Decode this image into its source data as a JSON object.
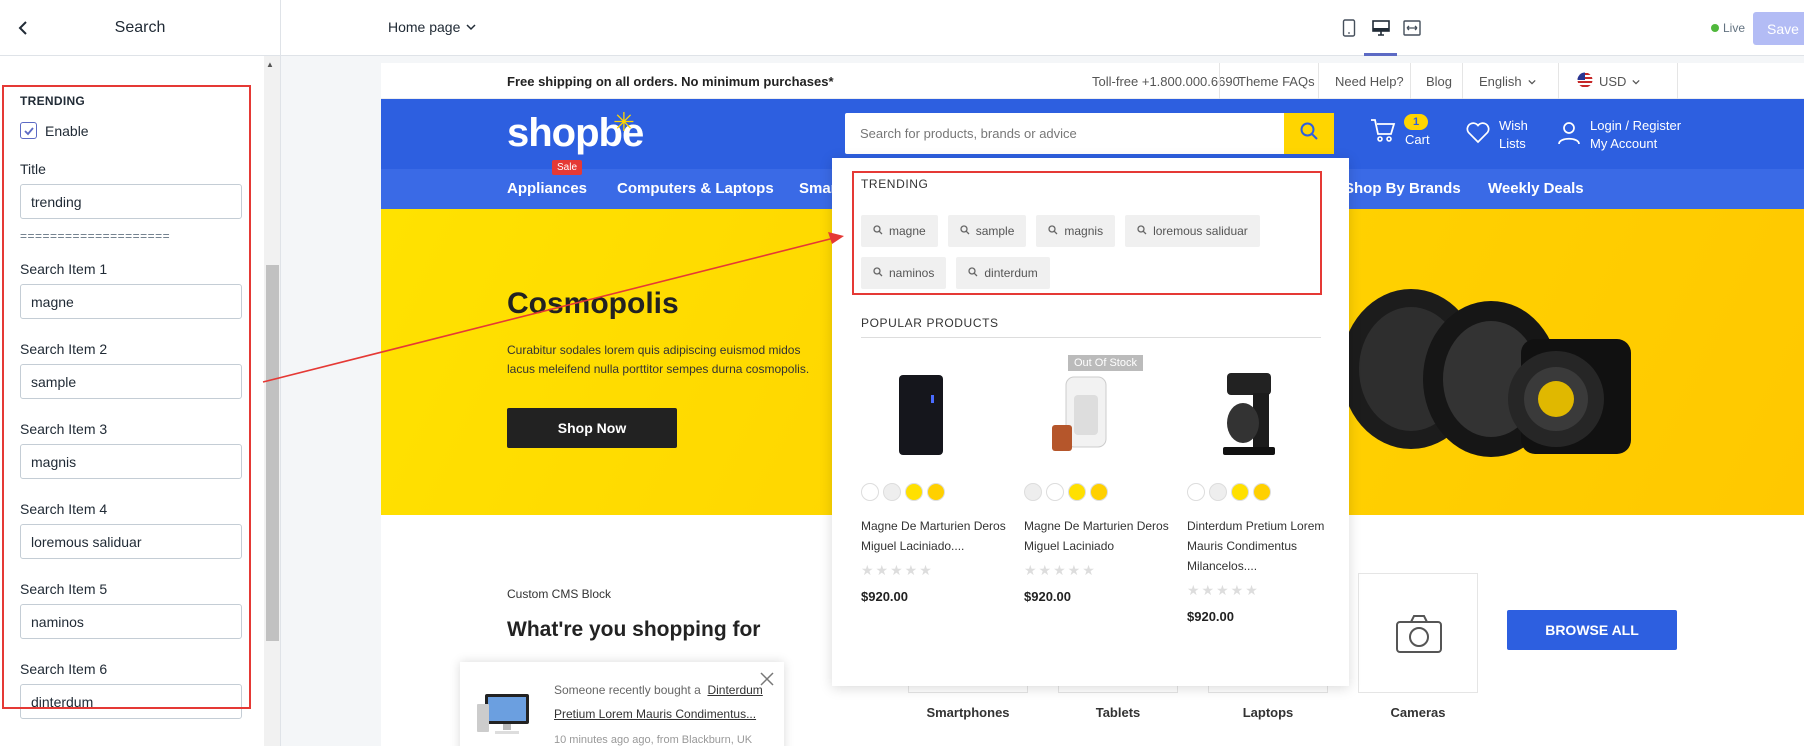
{
  "editor": {
    "title": "Search",
    "section_heading": "TRENDING",
    "enable_label": "Enable",
    "title_field_label": "Title",
    "title_field_value": "trending",
    "divider": "====================",
    "items": [
      {
        "label": "Search Item 1",
        "value": "magne"
      },
      {
        "label": "Search Item 2",
        "value": "sample"
      },
      {
        "label": "Search Item 3",
        "value": "magnis"
      },
      {
        "label": "Search Item 4",
        "value": "loremous saliduar"
      },
      {
        "label": "Search Item 5",
        "value": "naminos"
      },
      {
        "label": "Search Item 6",
        "value": "dinterdum"
      }
    ]
  },
  "topbar": {
    "page_select": "Home page",
    "live_label": "Live",
    "save_label": "Save"
  },
  "store": {
    "announcement": "Free shipping on all orders. No minimum purchases*",
    "tollfree": "Toll-free +1.800.000.6690",
    "links": [
      "Theme FAQs",
      "Need Help?",
      "Blog"
    ],
    "language": "English",
    "currency": "USD",
    "logo": "shopbe",
    "search_placeholder": "Search for products, brands or advice",
    "cart_count": "1",
    "cart_label": "Cart",
    "wish_line1": "Wish",
    "wish_line2": "Lists",
    "account_line1": "Login / Register",
    "account_line2": "My Account",
    "nav": [
      "Appliances",
      "Computers & Laptops",
      "Smar",
      "Shop By Brands",
      "Weekly Deals"
    ],
    "sale_badge": "Sale",
    "hero": {
      "title": "Cosmopolis",
      "text": "Curabitur sodales lorem quis adipiscing euismod midos lacus meleifend nulla porttitor sempes durna cosmopolis.",
      "button": "Shop Now"
    },
    "cms_label": "Custom CMS Block",
    "cms_title": "What're you shopping for",
    "categories": [
      "Smartphones",
      "Tablets",
      "Laptops",
      "Cameras"
    ],
    "browse_all": "BROWSE ALL",
    "toast": {
      "prefix": "Someone recently bought a",
      "product": "Dinterdum Pretium Lorem Mauris Condimentus...",
      "time": "10 minutes ago ago, from Blackburn, UK"
    }
  },
  "dropdown": {
    "trending_heading": "TRENDING",
    "trending": [
      "magne",
      "sample",
      "magnis",
      "loremous saliduar",
      "naminos",
      "dinterdum"
    ],
    "popular_heading": "POPULAR PRODUCTS",
    "out_of_stock": "Out Of Stock",
    "products": [
      {
        "name": "Magne De Marturien Deros Miguel Laciniado....",
        "price": "$920.00"
      },
      {
        "name": "Magne De Marturien Deros Miguel Laciniado",
        "price": "$920.00"
      },
      {
        "name": "Dinterdum Pretium Lorem Mauris Condimentus Milancelos....",
        "price": "$920.00"
      }
    ]
  },
  "colors": {
    "brand_blue": "#2d5fe0",
    "accent_yellow": "#ffd500",
    "annotation_red": "#e53935",
    "admin_purple": "#5c6ac4"
  }
}
